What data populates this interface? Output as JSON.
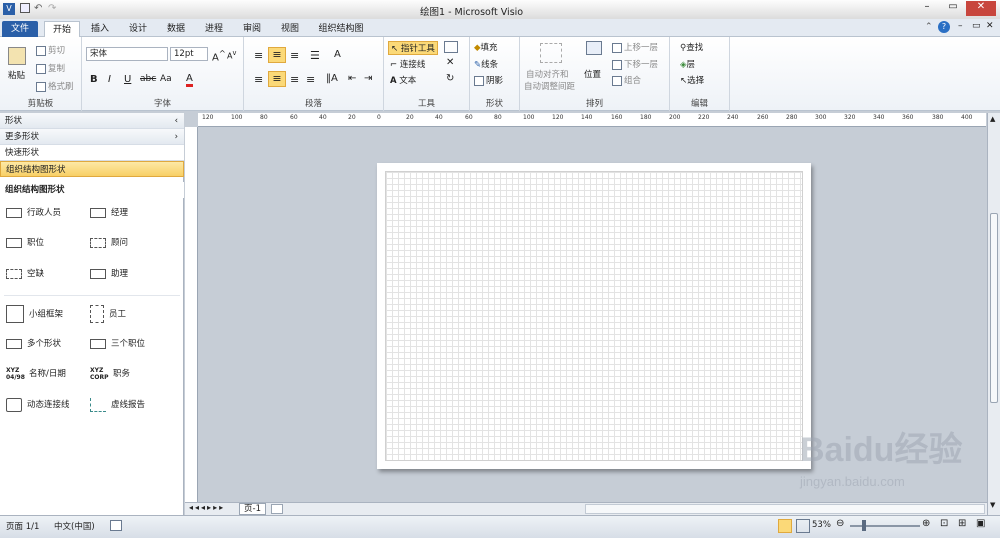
{
  "app": {
    "title": "绘图1 - Microsoft Visio"
  },
  "tabs": [
    {
      "label": "文件"
    },
    {
      "label": "开始"
    },
    {
      "label": "插入"
    },
    {
      "label": "设计"
    },
    {
      "label": "数据"
    },
    {
      "label": "进程"
    },
    {
      "label": "审阅"
    },
    {
      "label": "视图"
    },
    {
      "label": "组织结构图"
    }
  ],
  "ribbon": {
    "clipboard": {
      "paste": "粘贴",
      "cut": "剪切",
      "copy": "复制",
      "format_painter": "格式刷",
      "label": "剪贴板"
    },
    "font": {
      "name": "宋体",
      "size": "12pt",
      "label": "字体"
    },
    "paragraph": {
      "label": "段落"
    },
    "tools": {
      "pointer": "指针工具",
      "connector": "连接线",
      "text": "文本",
      "label": "工具"
    },
    "shape": {
      "fill": "填充",
      "line": "线条",
      "shadow": "阴影",
      "label": "形状"
    },
    "arrange": {
      "auto_align_1": "自动对齐和",
      "auto_align_2": "自动调整间距",
      "position": "位置",
      "bring_forward": "上移一层",
      "send_backward": "下移一层",
      "group": "组合",
      "label": "排列"
    },
    "editing": {
      "find": "查找",
      "layers": "层",
      "select": "选择",
      "label": "编辑"
    }
  },
  "shapes_panel": {
    "title": "形状",
    "more_shapes": "更多形状",
    "quick_shapes": "快速形状",
    "org_chart_shapes": "组织结构图形状",
    "section_title": "组织结构图形状",
    "items": [
      {
        "label": "行政人员"
      },
      {
        "label": "经理"
      },
      {
        "label": "职位"
      },
      {
        "label": "顾问"
      },
      {
        "label": "空缺"
      },
      {
        "label": "助理"
      },
      {
        "label": "小组框架"
      },
      {
        "label": "员工"
      },
      {
        "label": "多个形状"
      },
      {
        "label": "三个职位"
      },
      {
        "label": "名称/日期"
      },
      {
        "label": "职务"
      },
      {
        "label": "动态连接线"
      },
      {
        "label": "虚线报告"
      }
    ]
  },
  "ruler": {
    "labels": [
      "120",
      "100",
      "80",
      "60",
      "40",
      "20",
      "0",
      "20",
      "40",
      "60",
      "80",
      "100",
      "120",
      "140",
      "160",
      "180",
      "200",
      "220",
      "240",
      "260",
      "280",
      "300",
      "320",
      "340",
      "360",
      "380",
      "400"
    ]
  },
  "page_tabs": {
    "page": "页-1"
  },
  "status_bar": {
    "page": "页面 1/1",
    "language": "中文(中国)",
    "zoom": "53%"
  },
  "watermark": {
    "brand": "Baidu经验",
    "url": "jingyan.baidu.com"
  }
}
